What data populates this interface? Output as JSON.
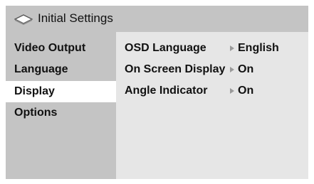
{
  "header": {
    "title": "Initial Settings",
    "icon": "disc-icon"
  },
  "sidebar": {
    "items": [
      {
        "label": "Video Output"
      },
      {
        "label": "Language"
      },
      {
        "label": "Display"
      },
      {
        "label": "Options"
      }
    ],
    "selected": "Display"
  },
  "settings": [
    {
      "label": "OSD Language",
      "value": "English"
    },
    {
      "label": "On Screen Display",
      "value": "On"
    },
    {
      "label": "Angle Indicator",
      "value": "On"
    }
  ],
  "colors": {
    "panel": "#c4c4c4",
    "content": "#e6e6e6",
    "selected": "#ffffff",
    "arrow": "#9a9a9a"
  }
}
